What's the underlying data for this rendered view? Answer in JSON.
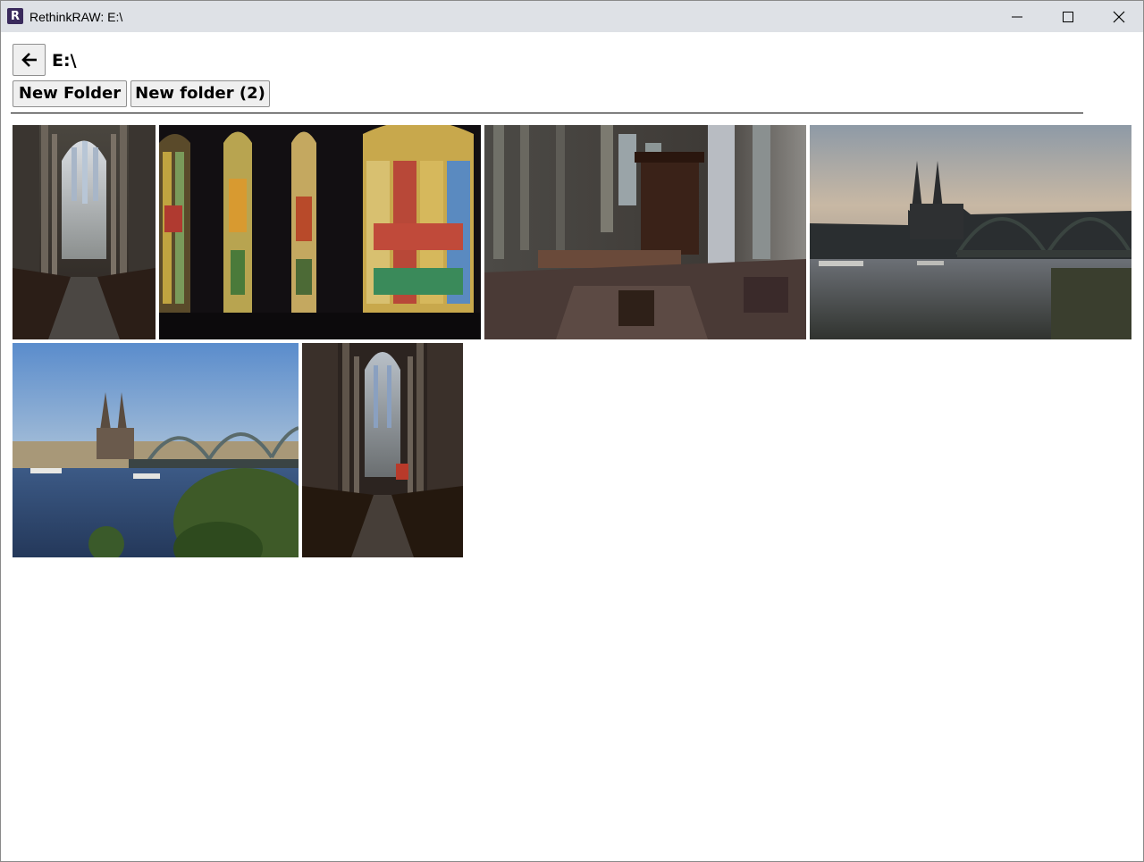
{
  "window": {
    "title": "RethinkRAW: E:\\",
    "app_icon_letter": "R",
    "icons": [
      "minimize-icon",
      "maximize-icon",
      "close-icon"
    ]
  },
  "nav": {
    "back_icon": "arrow-left-icon",
    "path": "E:\\"
  },
  "folders": [
    {
      "label": "New Folder"
    },
    {
      "label": "New folder (2)"
    }
  ],
  "photos": [
    {
      "subject": "cathedral-nave-vertical"
    },
    {
      "subject": "stained-glass-windows"
    },
    {
      "subject": "cathedral-pulpit-interior"
    },
    {
      "subject": "cathedral-bridge-dusk"
    },
    {
      "subject": "cathedral-bridge-day"
    },
    {
      "subject": "cathedral-nave-vertical-2"
    }
  ],
  "colors": {
    "titlebar": "#dee1e6",
    "button_bg": "#efefef",
    "button_border": "#8f8f8f",
    "app_icon": "#3a2a5c"
  }
}
